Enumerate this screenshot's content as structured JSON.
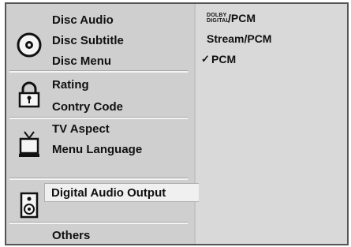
{
  "left_menu": {
    "disc_audio": "Disc Audio",
    "disc_subtitle": "Disc Subtitle",
    "disc_menu": "Disc Menu",
    "rating": "Rating",
    "country_code": "Contry Code",
    "tv_aspect": "TV Aspect",
    "menu_language": "Menu Language",
    "digital_audio_output": "Digital Audio Output",
    "others": "Others"
  },
  "right_panel": {
    "options": [
      {
        "logo_line1": "DOLBY",
        "logo_line2": "DIGITAL",
        "label": "/PCM"
      },
      {
        "label": "Stream/PCM"
      },
      {
        "label": "PCM",
        "checked": true,
        "check_mark": "✓"
      }
    ]
  },
  "icons": [
    "disc-icon",
    "padlock-icon",
    "tv-icon",
    "speaker-icon"
  ]
}
